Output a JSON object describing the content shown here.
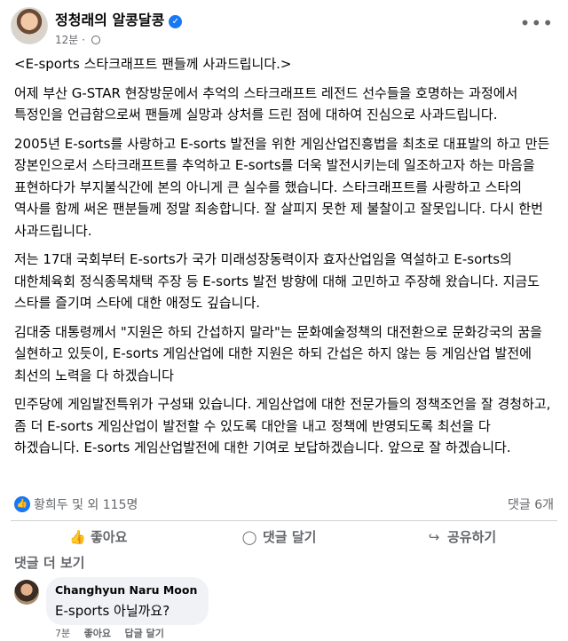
{
  "header": {
    "page_name": "정청래의 알콩달콩",
    "time": "12분",
    "more_icon": "more-horizontal-icon"
  },
  "post": {
    "paragraphs": [
      "<E-sports 스타크래프트 팬들께 사과드립니다.>",
      "어제 부산 G-STAR 현장방문에서 추억의 스타크래프트 레전드 선수들을 호명하는 과정에서 특정인을 언급함으로써 팬들께 실망과 상처를 드린 점에 대하여 진심으로 사과드립니다.",
      "2005년 E-sorts를 사랑하고 E-sorts 발전을 위한 게임산업진흥법을 최초로 대표발의 하고 만든 장본인으로서 스타크래프트를 추억하고 E-sorts를 더욱 발전시키는데 일조하고자 하는 마음을 표현하다가 부지불식간에 본의 아니게 큰 실수를 했습니다. 스타크래프트를 사랑하고 스타의 역사를 함께 써온 팬분들께 정말 죄송합니다. 잘 살피지 못한 제 불찰이고 잘못입니다. 다시 한번 사과드립니다.",
      "저는 17대 국회부터 E-sorts가 국가 미래성장동력이자 효자산업임을 역설하고 E-sorts의 대한체육회 정식종목채택 주장 등 E-sorts 발전 방향에 대해 고민하고 주장해 왔습니다. 지금도 스타를 즐기며 스타에 대한 애정도 깊습니다.",
      "김대중 대통령께서 \"지원은 하되 간섭하지 말라\"는 문화예술정책의 대전환으로 문화강국의 꿈을 실현하고 있듯이, E-sorts 게임산업에 대한 지원은 하되 간섭은 하지 않는 등 게임산업 발전에 최선의 노력을 다 하겠습니다",
      "민주당에 게임발전특위가 구성돼 있습니다. 게임산업에 대한 전문가들의 정책조언을 잘 경청하고, 좀 더 E-sorts 게임산업이 발전할 수 있도록 대안을 내고 정책에 반영되도록 최선을 다 하겠습니다.  E-sorts 게임산업발전에 대한 기여로 보답하겠습니다. 앞으로 잘 하겠습니다."
    ]
  },
  "stats": {
    "reactions": "황희두 및 외 115명",
    "comments": "댓글 6개"
  },
  "actions": {
    "like": "좋아요",
    "comment": "댓글 달기",
    "share": "공유하기"
  },
  "comments": {
    "more_label": "댓글 더 보기",
    "items": [
      {
        "author": "Changhyun Naru Moon",
        "text": "E-sports 아닐까요?",
        "time": "7분",
        "like": "좋아요",
        "reply": "답글 달기"
      }
    ]
  }
}
